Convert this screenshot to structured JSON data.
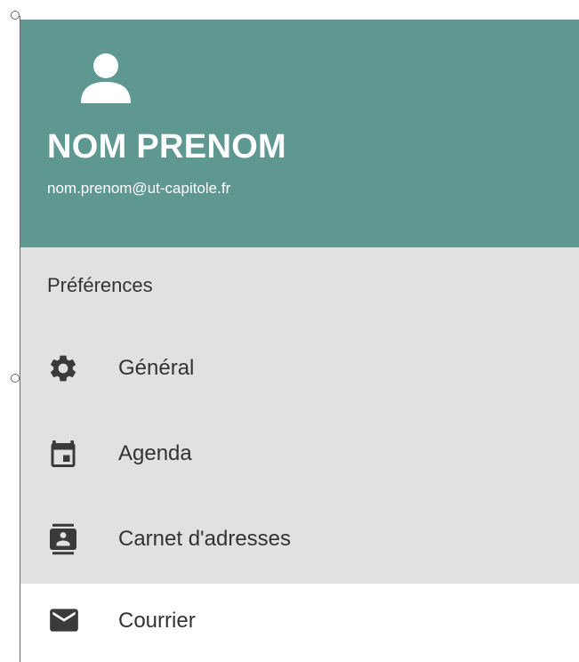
{
  "header": {
    "user_name": "NOM PRENOM",
    "user_email": "nom.prenom@ut-capitole.fr",
    "background_color": "#5f9791",
    "avatar_icon": "person-icon"
  },
  "preferences": {
    "title": "Préférences",
    "items": [
      {
        "label": "Général",
        "icon": "gear-icon"
      },
      {
        "label": "Agenda",
        "icon": "calendar-icon"
      },
      {
        "label": "Carnet d'adresses",
        "icon": "contact-book-icon"
      }
    ]
  },
  "mail": {
    "label": "Courrier",
    "icon": "envelope-icon"
  },
  "colors": {
    "menu_background": "#e1e1e1",
    "text": "#333333",
    "icon": "#3a3a3a"
  }
}
